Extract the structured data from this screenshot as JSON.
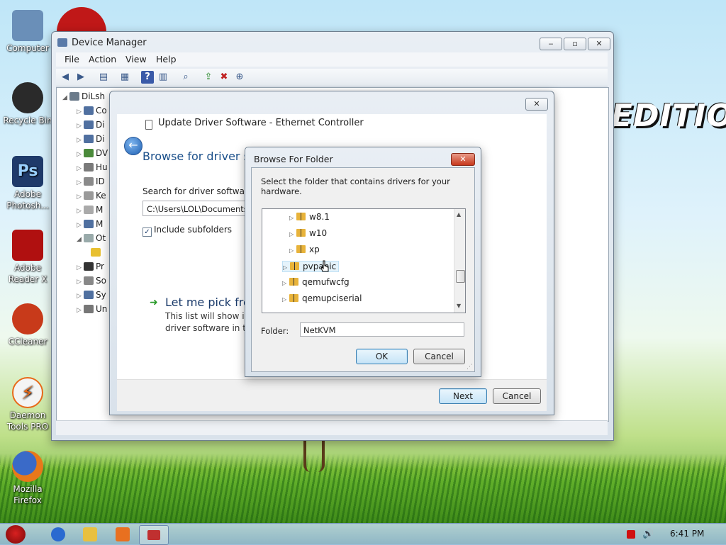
{
  "desktop": {
    "logo_text": "EDITION",
    "icons": [
      {
        "label": "Computer",
        "color": "#6a8fb8"
      },
      {
        "label": "Recycle Bin",
        "color": "#2a2a2a"
      },
      {
        "label": "Adobe Photosh...",
        "color": "#1f3a6a"
      },
      {
        "label": "Adobe Reader X",
        "color": "#b01010"
      },
      {
        "label": "CCleaner",
        "color": "#c83a1a"
      },
      {
        "label": "Daemon Tools PRO",
        "color": "#e86a1a"
      },
      {
        "label": "Mozilla Firefox",
        "color": "#e8781a"
      }
    ]
  },
  "device_manager": {
    "title": "Device Manager",
    "menu": [
      "File",
      "Action",
      "View",
      "Help"
    ],
    "root_label": "DiLsh",
    "nodes": [
      "Co",
      "Di",
      "Di",
      "DV",
      "Hu",
      "ID",
      "Ke",
      "M",
      "M",
      "Ot",
      "",
      "Pr",
      "So",
      "Sy",
      "Un"
    ]
  },
  "update_driver": {
    "title": "Update Driver Software - Ethernet Controller",
    "heading": "Browse for driver so",
    "search_label": "Search for driver software in",
    "path_value": "C:\\Users\\LOL\\Documents",
    "include_subfolders": "Include subfolders",
    "pick_title": "Let me pick fro",
    "pick_desc_1": "This list will show in",
    "pick_desc_2": "driver software in th",
    "next_label": "Next",
    "cancel_label": "Cancel"
  },
  "browse_folder": {
    "title": "Browse For Folder",
    "instruction": "Select the folder that contains drivers for your hardware.",
    "tree": [
      {
        "label": "w8.1",
        "indent": 1
      },
      {
        "label": "w10",
        "indent": 1
      },
      {
        "label": "xp",
        "indent": 1
      },
      {
        "label": "pvpanic",
        "indent": 0
      },
      {
        "label": "qemufwcfg",
        "indent": 0
      },
      {
        "label": "qemupciserial",
        "indent": 0
      }
    ],
    "folder_label": "Folder:",
    "folder_value": "NetKVM",
    "ok_label": "OK",
    "cancel_label": "Cancel",
    "close_glyph": "✕"
  },
  "taskbar": {
    "clock": "6:41 PM"
  }
}
